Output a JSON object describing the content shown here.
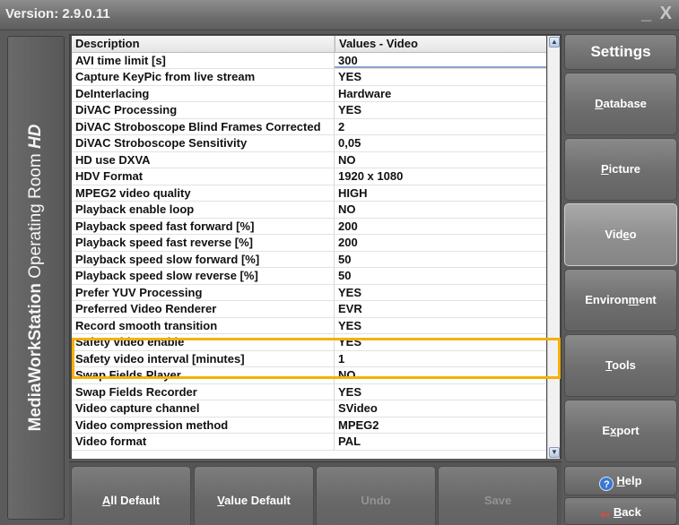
{
  "titlebar": {
    "version": "Version: 2.9.0.11",
    "minimize": "_",
    "close": "X"
  },
  "side_title": {
    "part1": "MediaWorkStation",
    "part2": "Operating Room",
    "part3": "HD"
  },
  "grid": {
    "columns": [
      "Description",
      "Values - Video"
    ],
    "rows": [
      [
        "AVI time limit [s]",
        "300"
      ],
      [
        "Capture KeyPic from live stream",
        "YES"
      ],
      [
        "DeInterlacing",
        "Hardware"
      ],
      [
        "DiVAC Processing",
        "YES"
      ],
      [
        "DiVAC Stroboscope Blind Frames Corrected",
        "2"
      ],
      [
        "DiVAC Stroboscope Sensitivity",
        "0,05"
      ],
      [
        "HD use DXVA",
        "NO"
      ],
      [
        "HDV Format",
        "1920 x 1080"
      ],
      [
        "MPEG2 video quality",
        "HIGH"
      ],
      [
        "Playback enable loop",
        "NO"
      ],
      [
        "Playback speed fast forward [%]",
        "200"
      ],
      [
        "Playback speed fast reverse [%]",
        "200"
      ],
      [
        "Playback speed slow forward [%]",
        "50"
      ],
      [
        "Playback speed slow reverse [%]",
        "50"
      ],
      [
        "Prefer YUV Processing",
        "YES"
      ],
      [
        "Preferred Video Renderer",
        "EVR"
      ],
      [
        "Record smooth transition",
        "YES"
      ],
      [
        "Safety video enable",
        "YES"
      ],
      [
        "Safety video interval [minutes]",
        "1"
      ],
      [
        "Swap Fields Player",
        "NO"
      ],
      [
        "Swap Fields Recorder",
        "YES"
      ],
      [
        "Video capture channel",
        "SVideo"
      ],
      [
        "Video compression method",
        "MPEG2"
      ],
      [
        "Video format",
        "PAL"
      ]
    ]
  },
  "bottom_buttons": {
    "all_default": {
      "pre": "",
      "u": "A",
      "post": "ll Default"
    },
    "value_default": {
      "pre": "",
      "u": "V",
      "post": "alue Default"
    },
    "undo": "Undo",
    "save": "Save"
  },
  "nav": {
    "title": "Settings",
    "database": {
      "pre": "",
      "u": "D",
      "post": "atabase"
    },
    "picture": {
      "pre": "",
      "u": "P",
      "post": "icture"
    },
    "video": {
      "pre": "Vid",
      "u": "e",
      "post": "o"
    },
    "environment": {
      "pre": "Environ",
      "u": "m",
      "post": "ent"
    },
    "tools": {
      "pre": "",
      "u": "T",
      "post": "ools"
    },
    "export": {
      "pre": "E",
      "u": "x",
      "post": "port"
    },
    "help": {
      "icon": "?",
      "pre": "",
      "u": "H",
      "post": "elp"
    },
    "back": {
      "icon": "⇐",
      "pre": "",
      "u": "B",
      "post": "ack"
    }
  },
  "highlight_color": "#f6b000",
  "active_nav": "video"
}
